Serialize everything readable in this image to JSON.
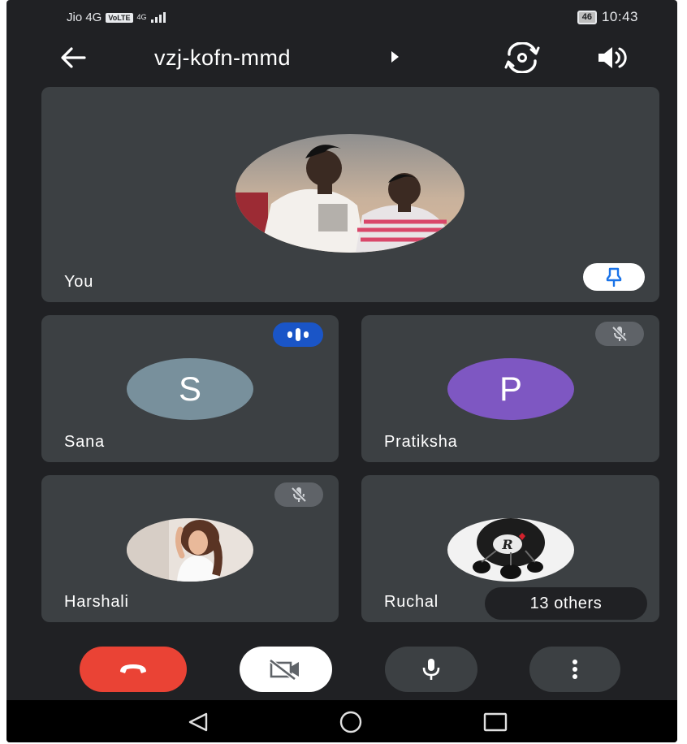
{
  "status_bar": {
    "carrier": "Jio 4G",
    "volte": "VoLTE",
    "network": "4G",
    "battery": "46",
    "time": "10:43"
  },
  "header": {
    "meeting_code": "vzj-kofn-mmd",
    "icons": [
      "back-arrow-icon",
      "caret-right-icon",
      "switch-camera-icon",
      "speaker-icon"
    ]
  },
  "tiles": {
    "self": {
      "name": "You",
      "pin_icon": "pin-icon"
    },
    "sana": {
      "name": "Sana",
      "initial": "S",
      "avatar_color": "#78909c",
      "status": "speaking"
    },
    "pratiksha": {
      "name": "Pratiksha",
      "initial": "P",
      "avatar_color": "#7e57c2",
      "status": "muted"
    },
    "harshali": {
      "name": "Harshali",
      "status": "muted"
    },
    "ruchal": {
      "name": "Ruchal",
      "others_label": "13 others"
    }
  },
  "controls": {
    "end_call_color": "#ea4335",
    "icons": [
      "end-call-icon",
      "camera-off-icon",
      "microphone-icon",
      "more-options-icon"
    ]
  },
  "nav_bar": {
    "icons": [
      "nav-back-icon",
      "nav-home-icon",
      "nav-recents-icon"
    ]
  },
  "colors": {
    "background": "#202124",
    "tile": "#3c4043",
    "speaking_badge": "#1a55c7",
    "pin_accent": "#1a73e8"
  }
}
